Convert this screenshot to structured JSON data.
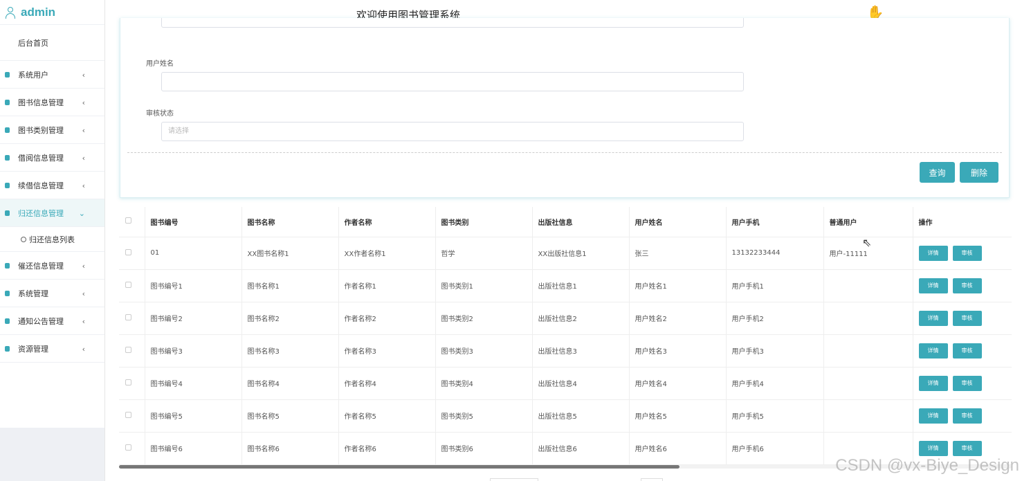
{
  "sidebar": {
    "brand": "admin",
    "home": "后台首页",
    "items": [
      {
        "label": "系统用户",
        "expanded": false
      },
      {
        "label": "图书信息管理",
        "expanded": false
      },
      {
        "label": "图书类别管理",
        "expanded": false
      },
      {
        "label": "借阅信息管理",
        "expanded": false
      },
      {
        "label": "续借信息管理",
        "expanded": false
      },
      {
        "label": "归还信息管理",
        "expanded": true
      },
      {
        "label": "催还信息管理",
        "expanded": false
      },
      {
        "label": "系统管理",
        "expanded": false
      },
      {
        "label": "通知公告管理",
        "expanded": false
      },
      {
        "label": "资源管理",
        "expanded": false
      }
    ],
    "submenu": {
      "label": "归还信息列表"
    },
    "collapsed_chevron": "‹",
    "expanded_chevron": "⌄"
  },
  "header": {
    "title": "欢迎使用图书管理系统"
  },
  "form": {
    "user_name_label": "用户姓名",
    "user_name_value": "",
    "status_label": "审核状态",
    "status_placeholder": "请选择",
    "query_button": "查询",
    "delete_button": "删除"
  },
  "table": {
    "headers": [
      "图书编号",
      "图书名称",
      "作者名称",
      "图书类别",
      "出版社信息",
      "用户姓名",
      "用户手机",
      "普通用户",
      "操作"
    ],
    "rows": [
      [
        "01",
        "XX图书名称1",
        "XX作者名称1",
        "哲学",
        "XX出版社信息1",
        "张三",
        "13132233444",
        "用户-11111"
      ],
      [
        "图书编号1",
        "图书名称1",
        "作者名称1",
        "图书类别1",
        "出版社信息1",
        "用户姓名1",
        "用户手机1",
        ""
      ],
      [
        "图书编号2",
        "图书名称2",
        "作者名称2",
        "图书类别2",
        "出版社信息2",
        "用户姓名2",
        "用户手机2",
        ""
      ],
      [
        "图书编号3",
        "图书名称3",
        "作者名称3",
        "图书类别3",
        "出版社信息3",
        "用户姓名3",
        "用户手机3",
        ""
      ],
      [
        "图书编号4",
        "图书名称4",
        "作者名称4",
        "图书类别4",
        "出版社信息4",
        "用户姓名4",
        "用户手机4",
        ""
      ],
      [
        "图书编号5",
        "图书名称5",
        "作者名称5",
        "图书类别5",
        "出版社信息5",
        "用户姓名5",
        "用户手机5",
        ""
      ],
      [
        "图书编号6",
        "图书名称6",
        "作者名称6",
        "图书类别6",
        "出版社信息6",
        "用户姓名6",
        "用户手机6",
        ""
      ]
    ],
    "detail_button": "详情",
    "review_button": "审核"
  },
  "watermark": "CSDN @vx-Biye_Design",
  "colors": {
    "accent": "#3aa9b8"
  }
}
